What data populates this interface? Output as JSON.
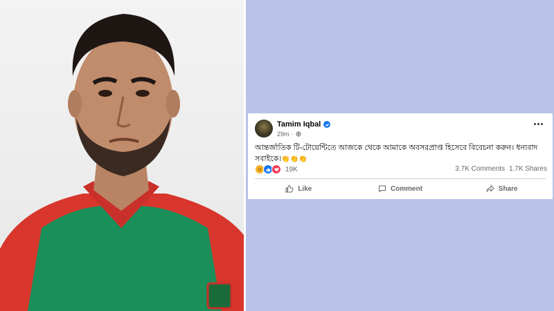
{
  "post": {
    "author": "Tamim Iqbal",
    "time": "29m",
    "text": "আন্তর্জাতিক টি-টোয়েন্টিতে আজকে থেকে আমাকে অবসরপ্রাপ্ত হিসেবে বিবেচনা করুন। ধন্যবাদ সবাইকে।",
    "emoji": "👏👏👏",
    "reaction_count": "19K",
    "comments": "3.7K Comments",
    "shares": "1.7K Shares"
  },
  "actions": {
    "like": "Like",
    "comment": "Comment",
    "share": "Share"
  },
  "colors": {
    "background": "#b9c2e7",
    "verified": "#1877f2",
    "jersey_green": "#1a8f5a",
    "jersey_red": "#d8362c"
  }
}
